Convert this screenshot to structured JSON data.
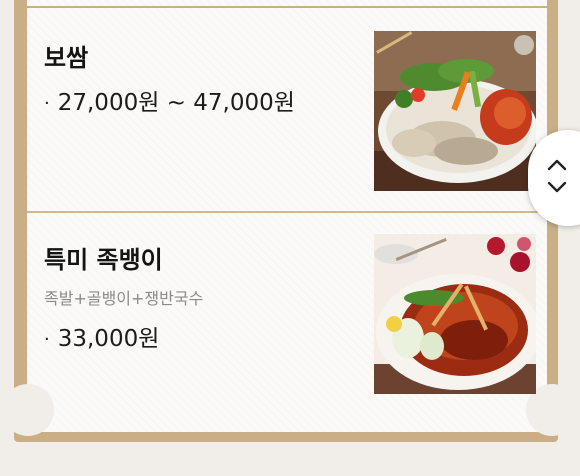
{
  "menu": {
    "items": [
      {
        "name": "보쌈",
        "price": "27,000원 ~ 47,000원",
        "photo_icon": "bossam-dish-photo"
      },
      {
        "name": "특미 족뱅이",
        "description": "족발+골뱅이+쟁반국수",
        "price": "33,000원",
        "photo_icon": "jokbaengi-dish-photo"
      }
    ],
    "bullet": "·"
  },
  "scroll_control": {
    "icon": "up-down-chevron-icon"
  },
  "colors": {
    "frame": "#c9ae86",
    "panel": "#fbfaf8",
    "background": "#f1ede8"
  }
}
